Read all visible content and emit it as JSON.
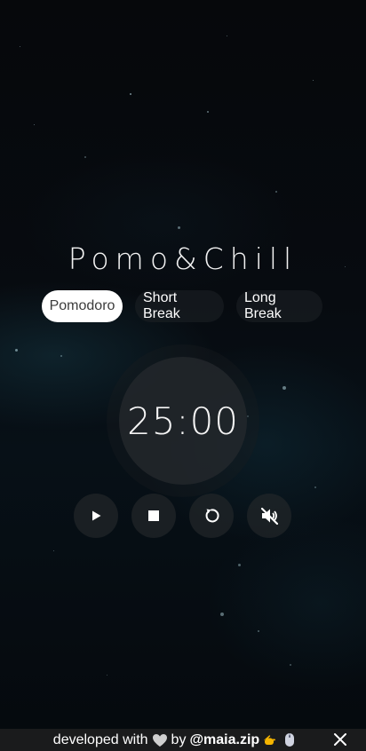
{
  "app": {
    "title": "Pomo&Chill"
  },
  "modes": {
    "items": [
      {
        "label": "Pomodoro",
        "active": true
      },
      {
        "label": "Short Break",
        "active": false
      },
      {
        "label": "Long Break",
        "active": false
      }
    ]
  },
  "timer": {
    "display": "25:00"
  },
  "controls": {
    "icons": [
      "play-icon",
      "stop-icon",
      "reset-icon",
      "mute-icon"
    ]
  },
  "footer": {
    "prefix": "developed with",
    "by": "by",
    "handle": "@maia.zip",
    "icons": [
      "heart-icon",
      "pointing-hand-icon",
      "mouse-icon"
    ],
    "close_icon": "close-icon"
  },
  "colors": {
    "background": "#05080b",
    "active_tab_bg": "#ffffff",
    "active_tab_text": "#3c3c3c",
    "text": "#ffffff",
    "footer_bg": "#1a1b1c"
  }
}
